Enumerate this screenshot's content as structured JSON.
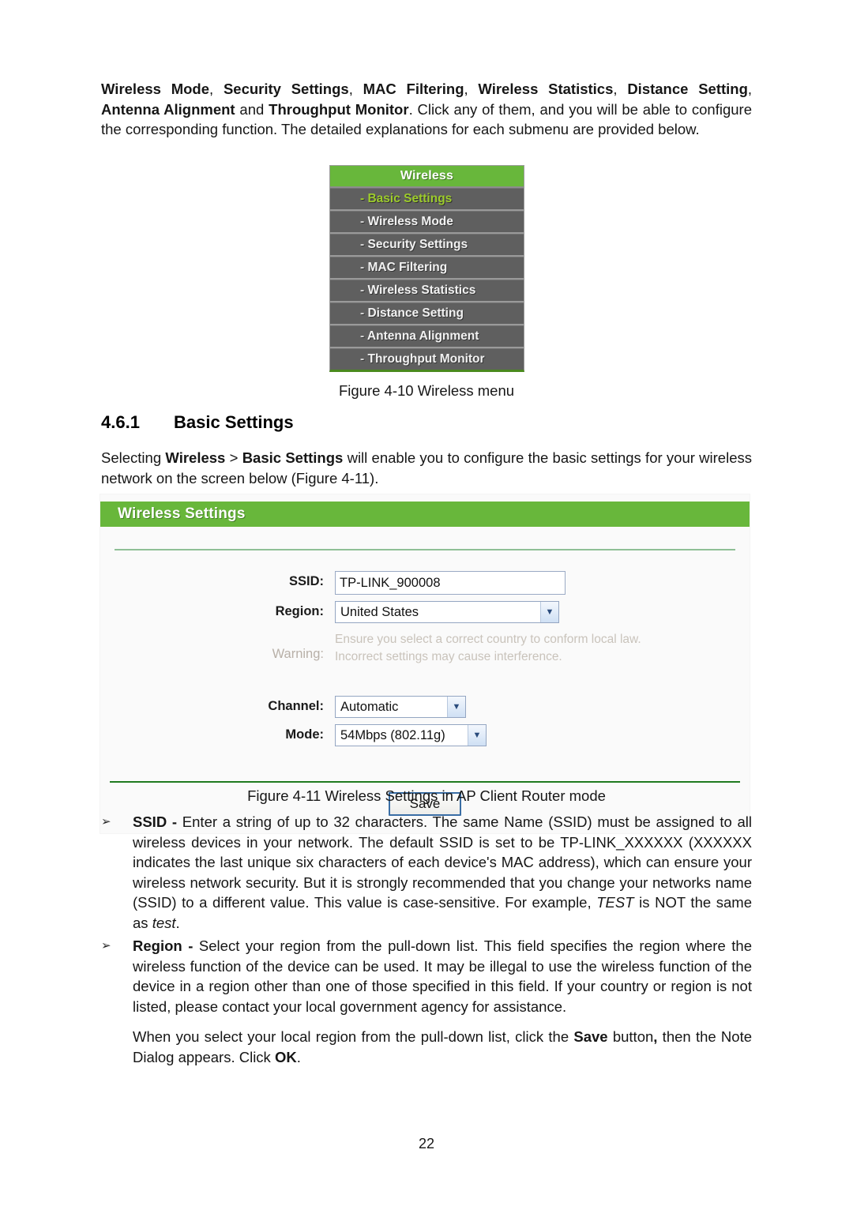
{
  "document": {
    "page_number": "22"
  },
  "intro_paragraph": {
    "segments": [
      {
        "text": "Wireless Mode",
        "bold": true
      },
      {
        "text": ", ",
        "bold": false
      },
      {
        "text": "Security Settings",
        "bold": true
      },
      {
        "text": ", ",
        "bold": false
      },
      {
        "text": "MAC Filtering",
        "bold": true
      },
      {
        "text": ", ",
        "bold": false
      },
      {
        "text": "Wireless Statistics",
        "bold": true
      },
      {
        "text": ", ",
        "bold": false
      },
      {
        "text": "Distance Setting",
        "bold": true
      },
      {
        "text": ", ",
        "bold": false
      },
      {
        "text": "Antenna Alignment",
        "bold": true
      },
      {
        "text": " and ",
        "bold": false
      },
      {
        "text": "Throughput Monitor",
        "bold": true
      },
      {
        "text": ". Click any of them, and you will be able to configure the corresponding function. The detailed explanations for each submenu are provided below.",
        "bold": false
      }
    ]
  },
  "wireless_menu": {
    "header": "Wireless",
    "items": [
      {
        "dash": "-",
        "label": "Basic Settings",
        "active": true
      },
      {
        "dash": "-",
        "label": "Wireless Mode",
        "active": false
      },
      {
        "dash": "-",
        "label": "Security Settings",
        "active": false
      },
      {
        "dash": "-",
        "label": "MAC Filtering",
        "active": false
      },
      {
        "dash": "-",
        "label": "Wireless Statistics",
        "active": false
      },
      {
        "dash": "-",
        "label": "Distance Setting",
        "active": false
      },
      {
        "dash": "-",
        "label": "Antenna Alignment",
        "active": false
      },
      {
        "dash": "-",
        "label": "Throughput Monitor",
        "active": false
      }
    ],
    "caption": "Figure 4-10 Wireless menu",
    "header_bg": "#68b73b",
    "item_bg": "#5f5f5f",
    "active_color": "#9dcc2b"
  },
  "section": {
    "number": "4.6.1",
    "title": "Basic Settings"
  },
  "selecting_paragraph": {
    "segments": [
      {
        "text": "Selecting ",
        "bold": false
      },
      {
        "text": "Wireless",
        "bold": true
      },
      {
        "text": " > ",
        "bold": false
      },
      {
        "text": "Basic Settings",
        "bold": true
      },
      {
        "text": " will enable you to configure the basic settings for your wireless network on the screen below (Figure 4-11).",
        "bold": false
      }
    ]
  },
  "wireless_settings_panel": {
    "title": "Wireless Settings",
    "fields": {
      "ssid": {
        "label": "SSID:",
        "value": "TP-LINK_900008",
        "placeholder": ""
      },
      "region": {
        "label": "Region:",
        "value": "United States"
      },
      "channel": {
        "label": "Channel:",
        "value": "Automatic"
      },
      "mode": {
        "label": "Mode:",
        "value": "54Mbps (802.11g)"
      }
    },
    "warning": {
      "label": "Warning:",
      "line1": "Ensure you select a correct country to conform local law.",
      "line2": "Incorrect settings may cause interference."
    },
    "save_label": "Save",
    "caption": "Figure 4-11 Wireless Settings in AP Client Router mode",
    "title_bg": "#68b73b"
  },
  "bullets": [
    {
      "marker": "➢",
      "segments": [
        {
          "text": "SSID -",
          "bold": true
        },
        {
          "text": " Enter a string of up to 32 characters. The same Name (SSID) must be assigned to all wireless devices in your network. The default SSID is set to be TP-LINK_XXXXXX (XXXXXX indicates the last unique six characters of each device's MAC address), which can ensure your wireless network security. But it is strongly recommended that you change your networks name (SSID) to a different value. This value is case-sensitive. For example, ",
          "bold": false
        },
        {
          "text": "TEST",
          "bold": false,
          "italic": true
        },
        {
          "text": " is NOT the same as ",
          "bold": false
        },
        {
          "text": "test",
          "bold": false,
          "italic": true
        },
        {
          "text": ".",
          "bold": false
        }
      ]
    },
    {
      "marker": "➢",
      "segments": [
        {
          "text": "Region -",
          "bold": true
        },
        {
          "text": " Select your region from the pull-down list. This field specifies the region where the wireless function of the device can be used. It may be illegal to use the wireless function of the device in a region other than one of those specified in this field. If your country or region is not listed, please contact your local government agency for assistance.",
          "bold": false
        }
      ]
    }
  ],
  "closing_paragraph": {
    "segments": [
      {
        "text": "When you select your local region from the pull-down list, click the ",
        "bold": false
      },
      {
        "text": "Save",
        "bold": true
      },
      {
        "text": " button",
        "bold": false
      },
      {
        "text": ",",
        "bold": true
      },
      {
        "text": " then the Note Dialog appears. Click ",
        "bold": false
      },
      {
        "text": "OK",
        "bold": true
      },
      {
        "text": ".",
        "bold": false
      }
    ]
  },
  "icons": {
    "dropdown_arrow": "chevron-down-icon",
    "bullet_marker": "arrow-bullet-icon"
  }
}
